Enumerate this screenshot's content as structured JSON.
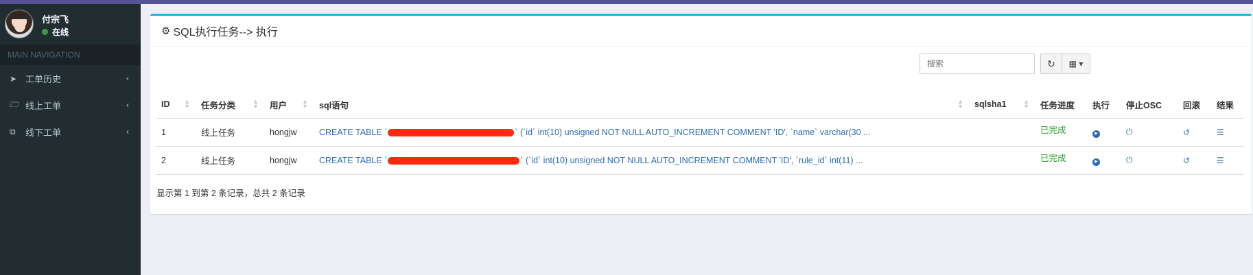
{
  "user": {
    "name": "付宗飞",
    "status": "在线"
  },
  "nav": {
    "header": "MAIN NAVIGATION",
    "items": [
      {
        "icon": "paper-plane-icon",
        "label": "工单历史"
      },
      {
        "icon": "folder-open-icon",
        "label": "线上工单"
      },
      {
        "icon": "clone-icon",
        "label": "线下工单"
      }
    ]
  },
  "box": {
    "title": "SQL执行任务--> 执行"
  },
  "toolbar": {
    "search_placeholder": "搜索"
  },
  "table": {
    "headers": [
      "ID",
      "任务分类",
      "用户",
      "sql语句",
      "sqlsha1",
      "任务进度",
      "执行",
      "停止OSC",
      "回滚",
      "结果"
    ],
    "rows": [
      {
        "id": "1",
        "category": "线上任务",
        "user": "hongjw",
        "sql_prefix": "CREATE TABLE `",
        "sql_suffix": "` (`id` int(10) unsigned NOT NULL AUTO_INCREMENT COMMENT 'ID', `name` varchar(30 ...",
        "sqlsha1": "",
        "progress": "已完成"
      },
      {
        "id": "2",
        "category": "线上任务",
        "user": "hongjw",
        "sql_prefix": "CREATE TABLE `",
        "sql_suffix": "` (`id` int(10) unsigned NOT NULL AUTO_INCREMENT COMMENT 'ID', `rule_id` int(11) ...",
        "sqlsha1": "",
        "progress": "已完成"
      }
    ]
  },
  "footer": {
    "summary": "显示第 1 到第 2 条记录，总共 2 条记录"
  },
  "colors": {
    "sidebar": "#222d32",
    "topbar": "#555299",
    "accent": "#1fb3e0",
    "link": "#2b6cb0",
    "success": "#2ea02e"
  }
}
